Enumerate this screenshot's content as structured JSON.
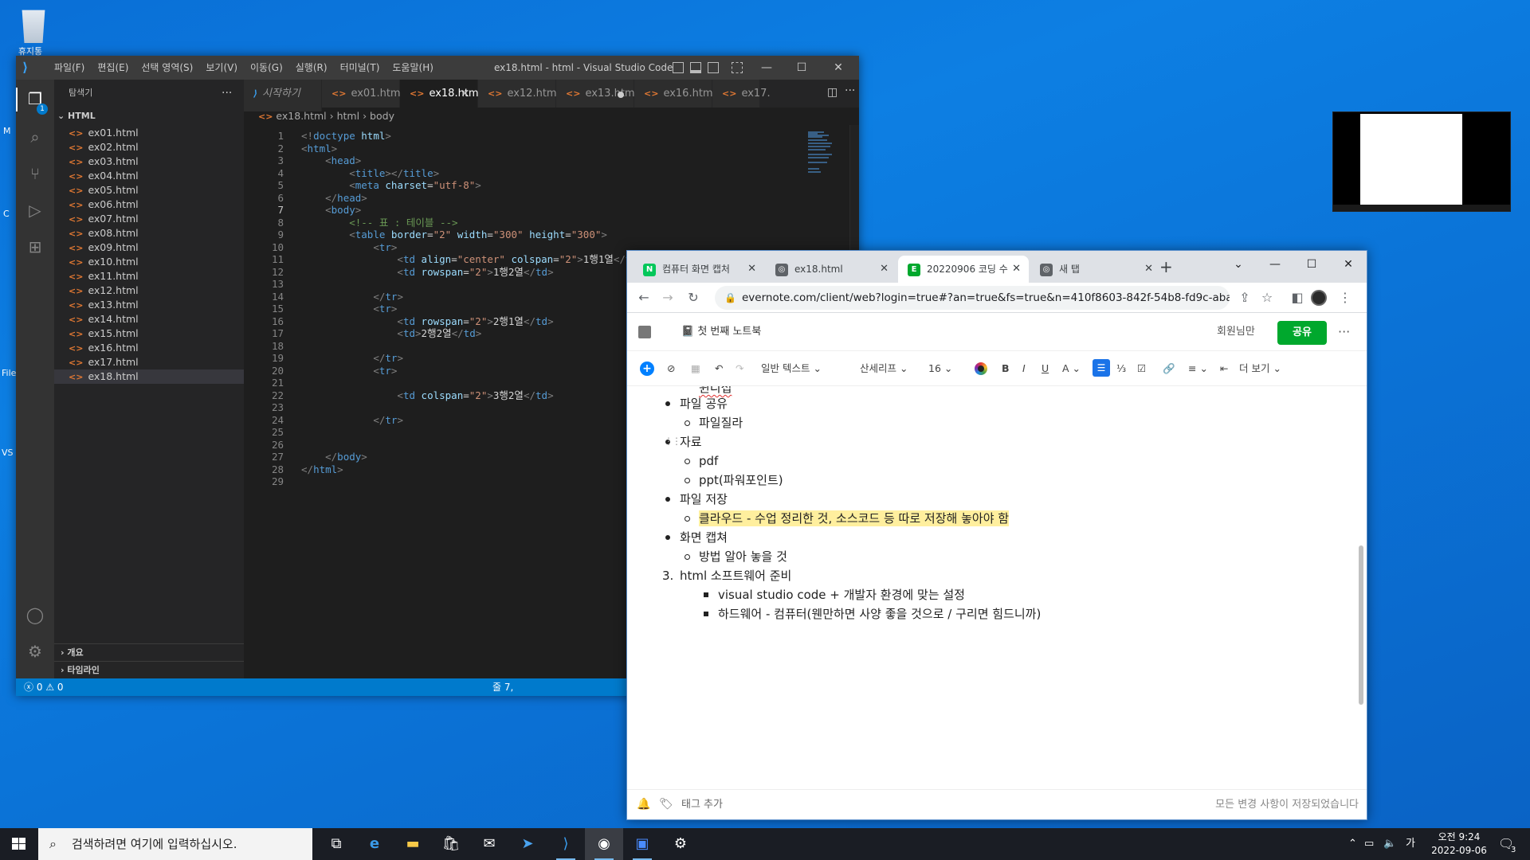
{
  "desktop": {
    "recycle_label": "휴지통",
    "side_labels": [
      "M",
      "C",
      "File",
      "VS"
    ]
  },
  "vscode": {
    "menu": [
      "파일(F)",
      "편집(E)",
      "선택 영역(S)",
      "보기(V)",
      "이동(G)",
      "실행(R)",
      "터미널(T)",
      "도움말(H)"
    ],
    "window_title": "ex18.html - html - Visual Studio Code",
    "explorer_title": "탐색기",
    "folder": "HTML",
    "files": [
      "ex01.html",
      "ex02.html",
      "ex03.html",
      "ex04.html",
      "ex05.html",
      "ex06.html",
      "ex07.html",
      "ex08.html",
      "ex09.html",
      "ex10.html",
      "ex11.html",
      "ex12.html",
      "ex13.html",
      "ex14.html",
      "ex15.html",
      "ex16.html",
      "ex17.html",
      "ex18.html"
    ],
    "active_file_index": 17,
    "outline_label": "개요",
    "timeline_label": "타임라인",
    "tabs": [
      {
        "label": "시작하기",
        "kind": "start"
      },
      {
        "label": "ex01.html"
      },
      {
        "label": "ex18.html",
        "active": true,
        "close": "×"
      },
      {
        "label": "ex12.html"
      },
      {
        "label": "ex13.html",
        "dirty": true
      },
      {
        "label": "ex16.html"
      },
      {
        "label": "ex17."
      }
    ],
    "breadcrumb": {
      "file": "ex18.html",
      "html": "html",
      "body": "body"
    },
    "current_line": 7,
    "status_errors": "0",
    "status_warnings": "0",
    "status_right": "줄 7,",
    "badge": "1"
  },
  "thumbnail": {},
  "chrome": {
    "tabs": [
      {
        "label": "컴퓨터 화면 캡처",
        "favicon": "N",
        "color": "#03c75a"
      },
      {
        "label": "ex18.html",
        "favicon": "◎",
        "color": "#5f6368"
      },
      {
        "label": "20220906 코딩 수",
        "favicon": "E",
        "color": "#00a82d",
        "active": true
      },
      {
        "label": "새 탭",
        "favicon": "◎",
        "color": "#5f6368"
      }
    ],
    "url": "evernote.com/client/web?login=true#?an=true&fs=true&n=410f8603-842f-54b8-fd9c-aba362...",
    "notebook": "첫 번째 노트북",
    "member": "회원님만",
    "share": "공유",
    "toolbar": {
      "text_style": "일반 텍스트",
      "font": "산세리프",
      "size": "16",
      "more": "더 보기"
    },
    "note": {
      "cut_top": "윈디섭",
      "items": [
        {
          "level": 1,
          "text": "파일 공유"
        },
        {
          "level": 2,
          "text": "파일질라"
        },
        {
          "level": 1,
          "text": "자료"
        },
        {
          "level": 2,
          "text": "pdf"
        },
        {
          "level": 2,
          "text": "ppt(파워포인트)"
        },
        {
          "level": 1,
          "text": "파일 저장"
        },
        {
          "level": 2,
          "text": "클라우드 - 수업 정리한 것, 소스코드 등 따로 저장해 놓아야 함"
        },
        {
          "level": 1,
          "text": "화면 캡쳐"
        },
        {
          "level": 2,
          "text": "방법 알아 놓을 것"
        },
        {
          "level": 0,
          "num": "3.",
          "text": "html  소프트웨어 준비"
        },
        {
          "level": 3,
          "text": "visual studio code + 개발자 환경에 맞는 설정"
        },
        {
          "level": 3,
          "text": "하드웨어 - 컴퓨터(웬만하면 사양 좋을 것으로 / 구리면 힘드니까)"
        }
      ]
    },
    "tag_add": "태그 추가",
    "saved": "모든 변경 사항이 저장되었습니다"
  },
  "taskbar": {
    "search_placeholder": "검색하려면 여기에 입력하십시오.",
    "time": "오전 9:24",
    "date": "2022-09-06",
    "ime": "가",
    "notif_count": "3"
  }
}
